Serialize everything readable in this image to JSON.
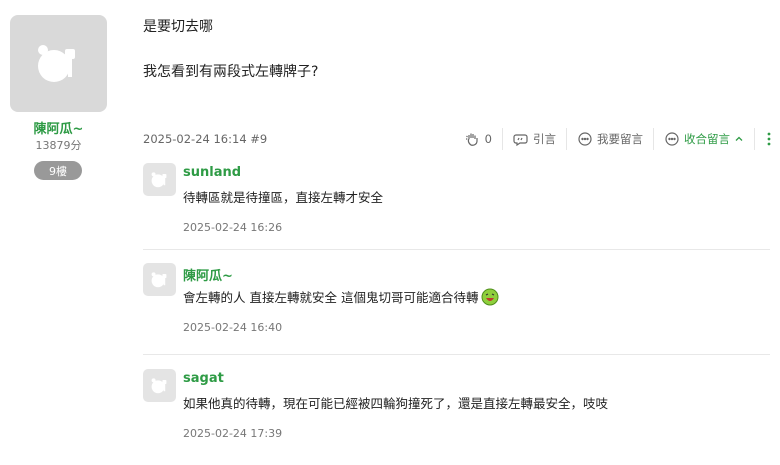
{
  "post": {
    "author": "陳阿瓜~",
    "score": "13879分",
    "floor": "9樓",
    "lines": [
      "是要切去哪",
      "我怎看到有兩段式左轉牌子?"
    ],
    "date": "2025-02-24 16:14 #9",
    "actions": {
      "gp_count": "0",
      "quote": "引言",
      "reply": "我要留言",
      "collapse": "收合留言"
    }
  },
  "comments": [
    {
      "name": "sunland",
      "text": "待轉區就是待撞區，直接左轉才安全",
      "time": "2025-02-24 16:26"
    },
    {
      "name": "陳阿瓜~",
      "text": "會左轉的人 直接左轉就安全 這個鬼切哥可能適合待轉",
      "time": "2025-02-24 16:40"
    },
    {
      "name": "sagat",
      "text": "如果他真的待轉，現在可能已經被四輪狗撞死了，還是直接左轉最安全，吱吱",
      "time": "2025-02-24 17:39"
    }
  ],
  "icons": {
    "avatar": "default-avatar-icon",
    "gp": "clap-hand-icon",
    "quote": "quote-bubble-icon",
    "reply": "comment-bubble-icon",
    "collapse": "comment-bubble-icon",
    "more": "kebab-menu-icon",
    "emoji": "green-laughing-face-icon"
  },
  "colors": {
    "accent": "#2e9b45",
    "avatar_bg": "#d9d9d9",
    "badge_bg": "#999999"
  }
}
